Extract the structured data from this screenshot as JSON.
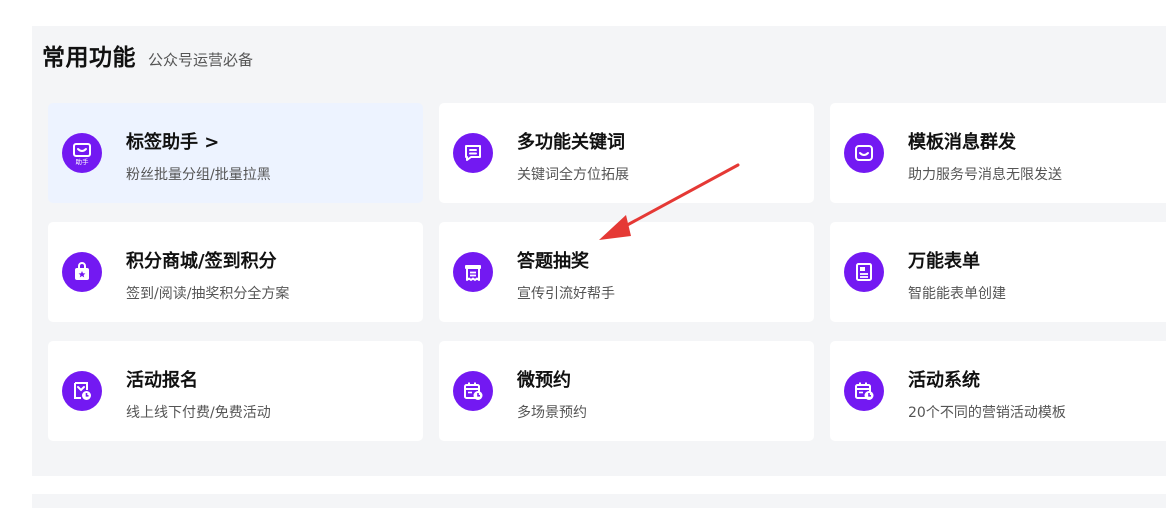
{
  "section": {
    "title": "常用功能",
    "subtitle": "公众号运营必备"
  },
  "cards": [
    {
      "title": "标签助手 >",
      "desc": "粉丝批量分组/批量拉黑",
      "icon": "tag-assistant-icon",
      "badge": "助手"
    },
    {
      "title": "多功能关键词",
      "desc": "关键词全方位拓展",
      "icon": "chat-keyword-icon"
    },
    {
      "title": "模板消息群发",
      "desc": "助力服务号消息无限发送",
      "icon": "message-smile-icon"
    },
    {
      "title": "积分商城/签到积分",
      "desc": "签到/阅读/抽奖积分全方案",
      "icon": "points-bag-icon"
    },
    {
      "title": "答题抽奖",
      "desc": "宣传引流好帮手",
      "icon": "receipt-printer-icon"
    },
    {
      "title": "万能表单",
      "desc": "智能能表单创建",
      "icon": "form-document-icon"
    },
    {
      "title": "活动报名",
      "desc": "线上线下付费/免费活动",
      "icon": "event-signup-icon"
    },
    {
      "title": "微预约",
      "desc": "多场景预约",
      "icon": "calendar-clock-icon"
    },
    {
      "title": "活动系统",
      "desc": "20个不同的营销活动模板",
      "icon": "calendar-clock-icon"
    }
  ],
  "colors": {
    "icon_bg": "#7319f2",
    "highlight_card_bg": "#edf3ff",
    "panel_bg": "#f4f5f7",
    "annotation_arrow": "#e53935"
  }
}
